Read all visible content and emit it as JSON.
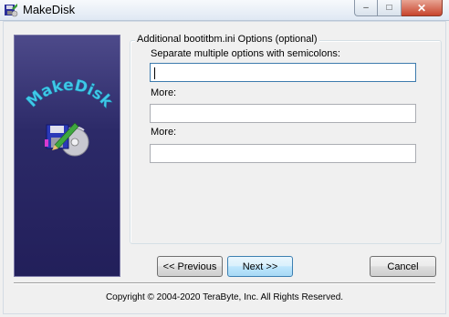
{
  "window": {
    "title": "MakeDisk",
    "controls": {
      "minimize": "–",
      "maximize": "□",
      "close": "✕"
    }
  },
  "sidepanel": {
    "logo_text": "MakeDisk",
    "colors": {
      "background": "#2c2a68",
      "logo_text": "#40c8e8"
    }
  },
  "options": {
    "group_title": "Additional bootitbm.ini Options (optional)",
    "fields": [
      {
        "label": "Separate multiple options with semicolons:",
        "value": ""
      },
      {
        "label": "More:",
        "value": ""
      },
      {
        "label": "More:",
        "value": ""
      }
    ]
  },
  "buttons": {
    "previous": "<< Previous",
    "next": "Next >>",
    "cancel": "Cancel"
  },
  "footer": {
    "copyright": "Copyright © 2004-2020 TeraByte, Inc.  All Rights Reserved."
  }
}
